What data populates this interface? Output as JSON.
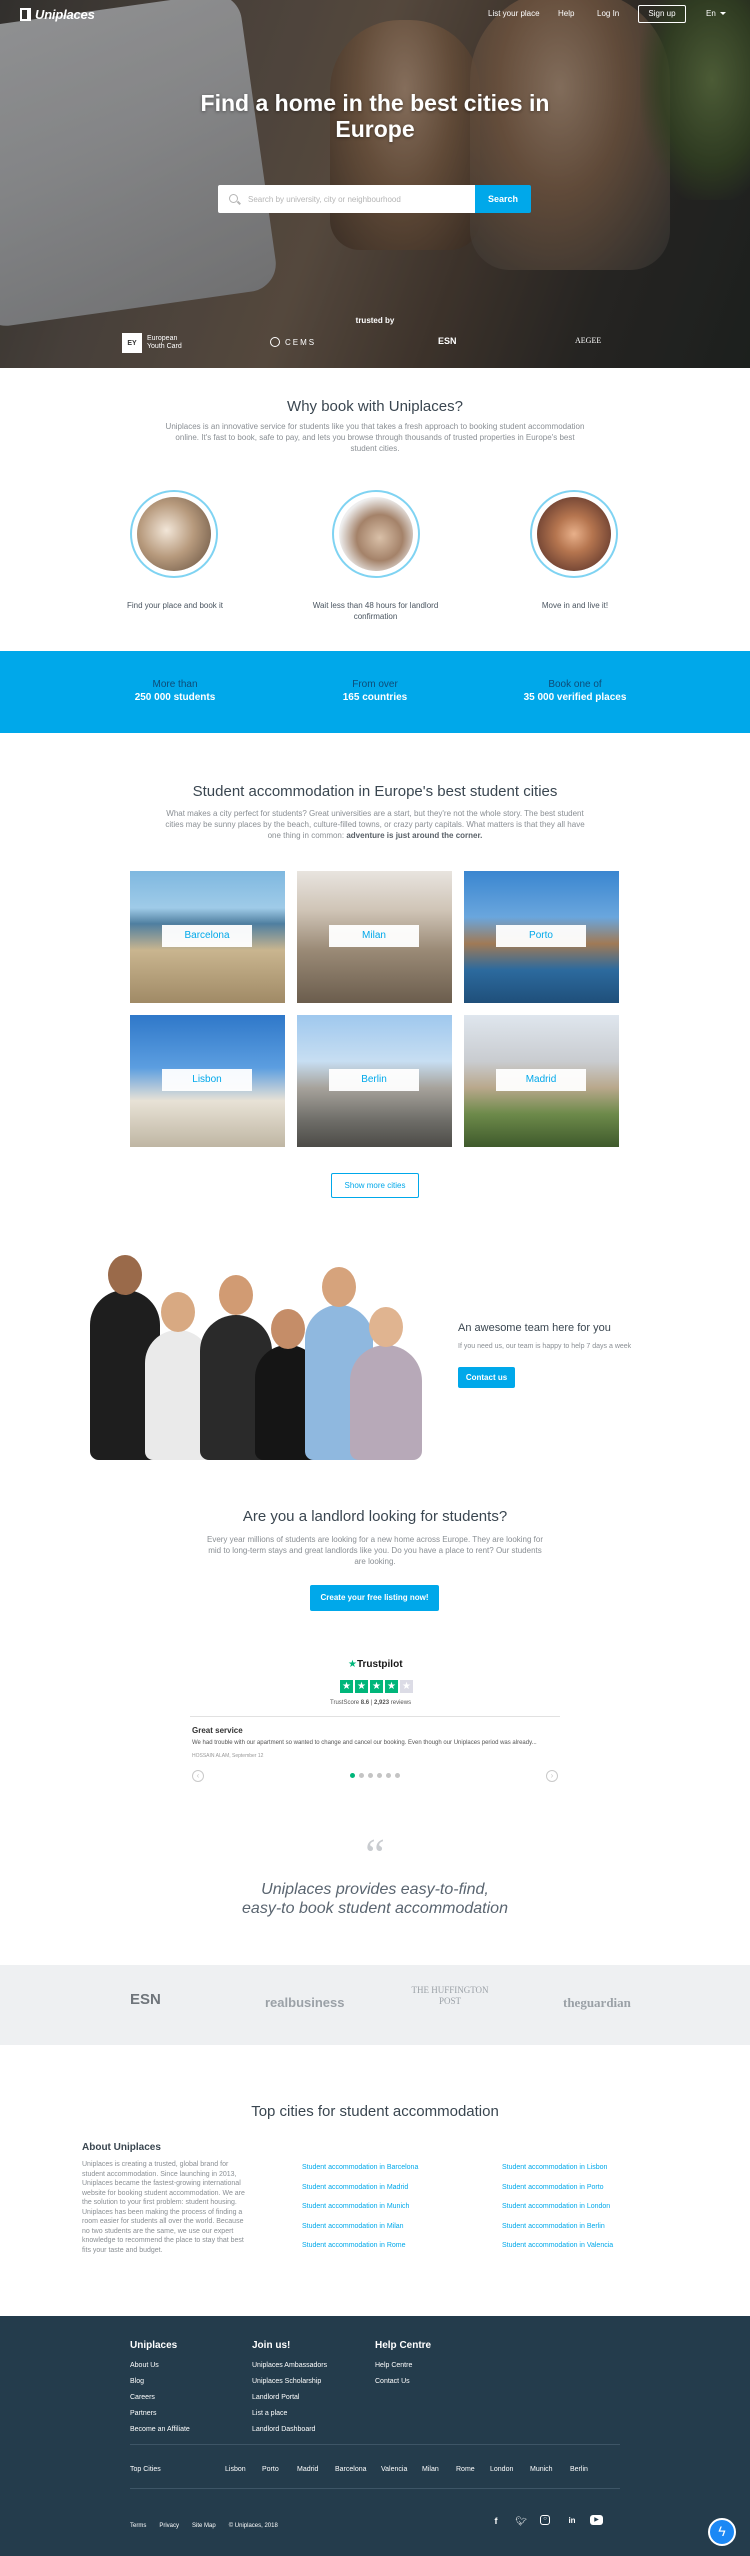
{
  "nav": {
    "logo": "Uniplaces",
    "links": [
      "List your place",
      "Help",
      "Log In"
    ],
    "signup": "Sign up",
    "language": "En"
  },
  "hero": {
    "title": "Find a home in the best cities in Europe",
    "search_placeholder": "Search by university, city or neighbourhood",
    "search_button": "Search",
    "trusted_by": "trusted by",
    "partners": [
      "European Youth Card",
      "CEMS",
      "ESN",
      "AEGEE"
    ]
  },
  "why": {
    "title": "Why book with Uniplaces?",
    "text": "Uniplaces is an innovative service for students like you that takes a fresh approach to booking student accommodation online. It's fast to book, safe to pay, and lets you browse through thousands of trusted properties in Europe's best student cities.",
    "features": [
      "Find your place and book it",
      "Wait less than 48 hours for landlord confirmation",
      "Move in and live it!"
    ]
  },
  "stats": [
    {
      "line1": "More than",
      "line2": "250 000 students"
    },
    {
      "line1": "From over",
      "line2": "165 countries"
    },
    {
      "line1": "Book one of",
      "line2": "35 000 verified places"
    }
  ],
  "cities_section": {
    "title": "Student accommodation in Europe's best student cities",
    "text": "What makes a city perfect for students? Great universities are a start, but they're not the whole story. The best student cities may be sunny places by the beach, culture-filled towns, or crazy party capitals. What matters is that they all have one thing in common:",
    "text_bold": "adventure is just around the corner.",
    "cities": [
      "Barcelona",
      "Milan",
      "Porto",
      "Lisbon",
      "Berlin",
      "Madrid"
    ],
    "more_button": "Show more cities"
  },
  "team": {
    "title": "An awesome team here for you",
    "text": "If you need us, our team is happy to help 7 days a week",
    "button": "Contact us"
  },
  "landlord": {
    "title": "Are you a landlord looking for students?",
    "text": "Every year millions of students are looking for a new home across Europe. They are looking for mid to long-term stays and great landlords like you. Do you have a place to rent? Our students are looking.",
    "button": "Create your free listing now!"
  },
  "trustpilot": {
    "brand": "Trustpilot",
    "score_label": "TrustScore",
    "score": "8.6",
    "reviews": "2,923",
    "reviews_label": "reviews",
    "review_title": "Great service",
    "review_text": "We had trouble with our apartment so wanted to change and cancel our booking. Even though our Uniplaces period was already...",
    "review_meta": "HOSSAIN ALAM, September 12",
    "rating_stars": 4
  },
  "quote": {
    "mark": "“",
    "text": "Uniplaces provides easy-to-find, easy-to book student accommodation"
  },
  "press": [
    "ESN",
    "realbusiness",
    "THE HUFFINGTON POST",
    "theguardian"
  ],
  "top_cities": {
    "title": "Top cities for student accommodation",
    "about_title": "About Uniplaces",
    "about_text": "Uniplaces is creating a trusted, global brand for student accommodation. Since launching in 2013, Uniplaces became the fastest-growing international website for booking student accommodation. We are the solution to your first problem: student housing. Uniplaces has been making the process of finding a room easier for students all over the world. Because no two students are the same, we use our expert knowledge to recommend the place to stay that best fits your taste and budget.",
    "col1": [
      "Student accommodation in Barcelona",
      "Student accommodation in Madrid",
      "Student accommodation in Munich",
      "Student accommodation in Milan",
      "Student accommodation in Rome"
    ],
    "col2": [
      "Student accommodation in Lisbon",
      "Student accommodation in Porto",
      "Student accommodation in London",
      "Student accommodation in Berlin",
      "Student accommodation in Valencia"
    ]
  },
  "footer": {
    "uniplaces": {
      "title": "Uniplaces",
      "links": [
        "About Us",
        "Blog",
        "Careers",
        "Partners",
        "Become an Affiliate"
      ]
    },
    "join": {
      "title": "Join us!",
      "links": [
        "Uniplaces Ambassadors",
        "Uniplaces Scholarship",
        "Landlord Portal",
        "List a place",
        "Landlord Dashboard"
      ]
    },
    "help": {
      "title": "Help Centre",
      "links": [
        "Help Centre",
        "Contact Us"
      ]
    },
    "top_cities_label": "Top Cities",
    "cities": [
      "Lisbon",
      "Porto",
      "Madrid",
      "Barcelona",
      "Valencia",
      "Milan",
      "Rome",
      "London",
      "Munich",
      "Berlin"
    ],
    "bottom_links": [
      "Terms",
      "Privacy",
      "Site Map"
    ],
    "copyright": "© Uniplaces, 2018",
    "social": [
      "facebook-icon",
      "twitter-icon",
      "instagram-icon",
      "linkedin-icon",
      "youtube-icon"
    ]
  },
  "colors": {
    "accent": "#00a8ea",
    "footer_bg": "#243c4c",
    "trustpilot_green": "#00b67a"
  }
}
